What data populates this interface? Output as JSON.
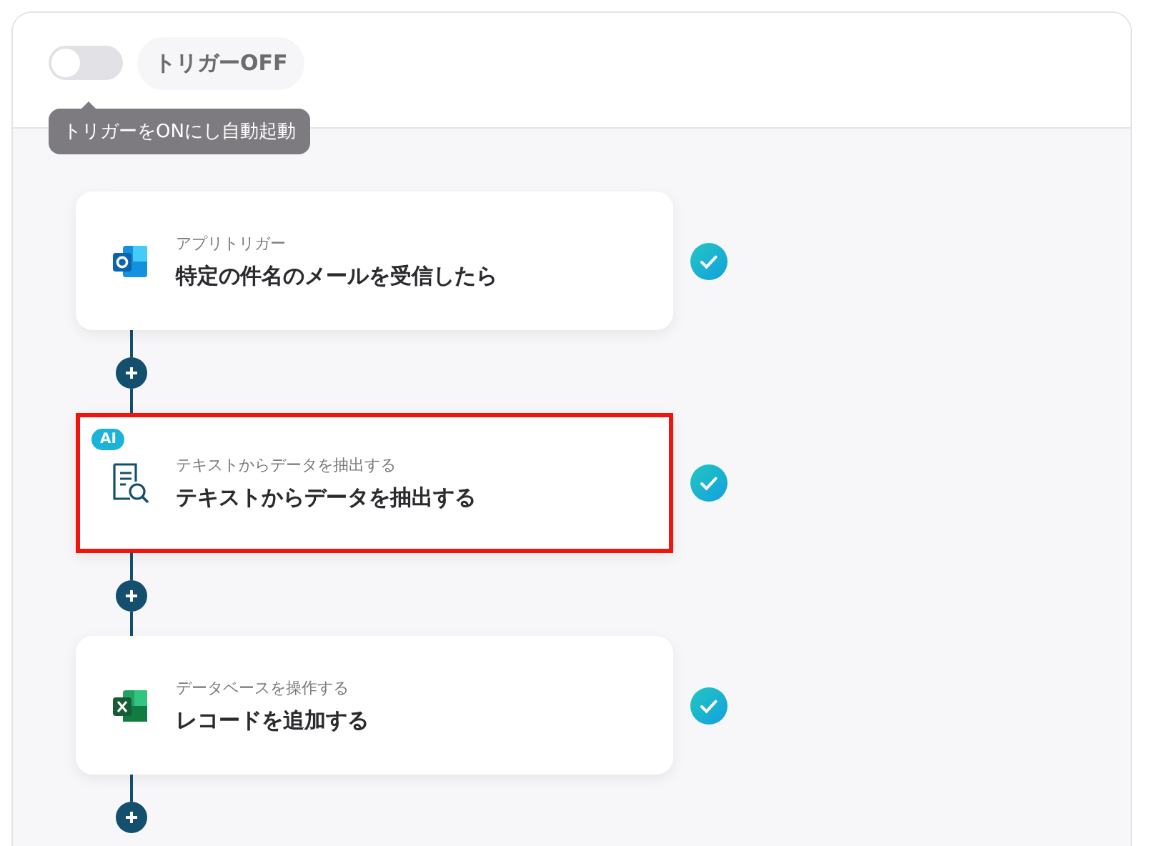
{
  "trigger": {
    "on": false,
    "label": "トリガーOFF",
    "tooltip": "トリガーをONにし自動起動"
  },
  "steps": [
    {
      "kind": "outlook",
      "subtitle": "アプリトリガー",
      "title": "特定の件名のメールを受信したら",
      "highlighted": false,
      "done": true
    },
    {
      "kind": "ai",
      "badge": "AI",
      "subtitle": "テキストからデータを抽出する",
      "title": "テキストからデータを抽出する",
      "highlighted": true,
      "done": true
    },
    {
      "kind": "excel",
      "subtitle": "データベースを操作する",
      "title": "レコードを追加する",
      "highlighted": false,
      "done": true
    }
  ]
}
